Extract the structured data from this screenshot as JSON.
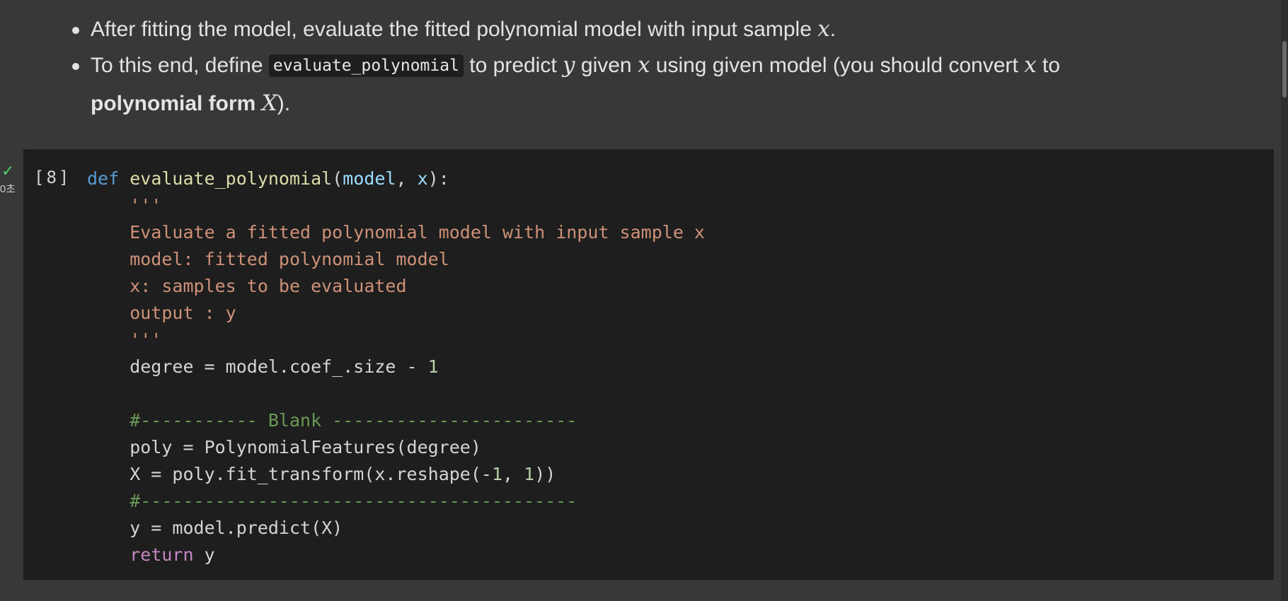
{
  "text_cell": {
    "bullet1": {
      "before": "After fitting the model, evaluate the fitted polynomial model with input sample ",
      "math_x": "x",
      "after": "."
    },
    "bullet2": {
      "part1": "To this end, define ",
      "code": "evaluate_polynomial",
      "part2": " to predict ",
      "math_y": "y",
      "part3": " given ",
      "math_x": "x",
      "part4": " using given model (you should convert ",
      "math_x2": "x",
      "part5": " to",
      "bold_text": "polynomial form",
      "math_X": "X",
      "part6": ")."
    }
  },
  "code_cell": {
    "execution_count": "[8]",
    "status_icon": "check-icon",
    "status_time": "0초",
    "lines": [
      [
        {
          "t": "def",
          "c": "kw"
        },
        {
          "t": " ",
          "c": "plain"
        },
        {
          "t": "evaluate_polynomial",
          "c": "fn"
        },
        {
          "t": "(",
          "c": "plain"
        },
        {
          "t": "model",
          "c": "param"
        },
        {
          "t": ", ",
          "c": "plain"
        },
        {
          "t": "x",
          "c": "param"
        },
        {
          "t": "):",
          "c": "plain"
        }
      ],
      [
        {
          "t": "    '''",
          "c": "str"
        }
      ],
      [
        {
          "t": "    Evaluate a fitted polynomial model with input sample x",
          "c": "str"
        }
      ],
      [
        {
          "t": "    model: fitted polynomial model",
          "c": "str"
        }
      ],
      [
        {
          "t": "    x: samples to be evaluated",
          "c": "str"
        }
      ],
      [
        {
          "t": "    output : y",
          "c": "str"
        }
      ],
      [
        {
          "t": "    '''",
          "c": "str"
        }
      ],
      [
        {
          "t": "    degree = model.coef_.size - ",
          "c": "plain"
        },
        {
          "t": "1",
          "c": "num"
        }
      ],
      [],
      [
        {
          "t": "    #----------- Blank -----------------------",
          "c": "cmt"
        }
      ],
      [
        {
          "t": "    poly = PolynomialFeatures(degree)",
          "c": "plain"
        }
      ],
      [
        {
          "t": "    X = poly.fit_transform(x.reshape(-",
          "c": "plain"
        },
        {
          "t": "1",
          "c": "num"
        },
        {
          "t": ", ",
          "c": "plain"
        },
        {
          "t": "1",
          "c": "num"
        },
        {
          "t": "))",
          "c": "plain"
        }
      ],
      [
        {
          "t": "    #-----------------------------------------",
          "c": "cmt"
        }
      ],
      [
        {
          "t": "    y = model.predict(X)",
          "c": "plain"
        }
      ],
      [
        {
          "t": "    ",
          "c": "plain"
        },
        {
          "t": "return",
          "c": "kw-ctrl"
        },
        {
          "t": " y",
          "c": "plain"
        }
      ]
    ]
  },
  "colors": {
    "background": "#383838",
    "code_background": "#1e1e1e",
    "keyword": "#569cd6",
    "control_keyword": "#c586c0",
    "function": "#dcdcaa",
    "parameter": "#9cdcfe",
    "string": "#ce9178",
    "comment": "#6a9955",
    "number": "#b5cea8",
    "success": "#4ccf6a"
  }
}
